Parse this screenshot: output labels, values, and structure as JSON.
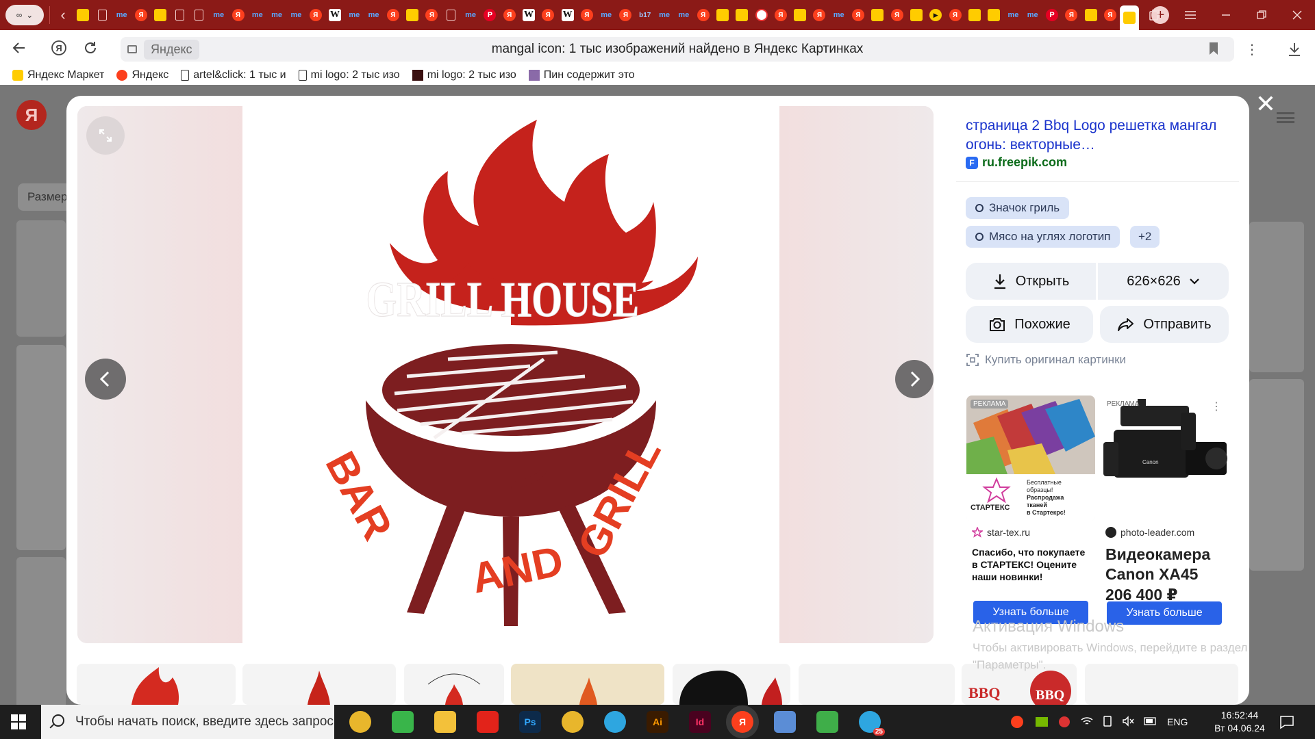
{
  "browser": {
    "window_title": "mangal icon: 1 тыс изображений найдено в Яндекс Картинках",
    "site_chip": "Яндекс",
    "new_tab_symbol": "+",
    "tabs": [
      {
        "icon": "market-icon"
      },
      {
        "icon": "doc-icon"
      },
      {
        "icon": "me-icon",
        "text": "me"
      },
      {
        "icon": "yandex-icon",
        "text": "Я"
      },
      {
        "icon": "market-icon"
      },
      {
        "icon": "doc-icon"
      },
      {
        "icon": "doc-icon"
      },
      {
        "icon": "me-icon",
        "text": "me"
      },
      {
        "icon": "yandex-icon",
        "text": "Я"
      },
      {
        "icon": "me-icon",
        "text": "me"
      },
      {
        "icon": "me-icon",
        "text": "me"
      },
      {
        "icon": "me-icon",
        "text": "me"
      },
      {
        "icon": "yandex-icon",
        "text": "Я"
      },
      {
        "icon": "wiki-icon",
        "text": "W"
      },
      {
        "icon": "me-icon",
        "text": "me"
      },
      {
        "icon": "me-icon",
        "text": "me"
      },
      {
        "icon": "yandex-icon",
        "text": "Я"
      },
      {
        "icon": "market-icon"
      },
      {
        "icon": "yandex-icon",
        "text": "Я"
      },
      {
        "icon": "doc-icon"
      },
      {
        "icon": "me-icon",
        "text": "me"
      },
      {
        "icon": "pinterest-icon",
        "text": "P"
      },
      {
        "icon": "yandex-icon",
        "text": "Я"
      },
      {
        "icon": "wiki-icon",
        "text": "W"
      },
      {
        "icon": "yandex-icon",
        "text": "Я"
      },
      {
        "icon": "wiki-icon",
        "text": "W"
      },
      {
        "icon": "yandex-icon",
        "text": "Я"
      },
      {
        "icon": "me-icon",
        "text": "me"
      },
      {
        "icon": "yandex-icon",
        "text": "Я"
      },
      {
        "icon": "b17-icon",
        "text": "b17"
      },
      {
        "icon": "me-icon",
        "text": "me"
      },
      {
        "icon": "me-icon",
        "text": "me"
      },
      {
        "icon": "yandex-icon",
        "text": "Я"
      },
      {
        "icon": "market-icon"
      },
      {
        "icon": "market-icon"
      },
      {
        "icon": "pokeball-icon"
      },
      {
        "icon": "yandex-icon",
        "text": "Я"
      },
      {
        "icon": "market-icon"
      },
      {
        "icon": "yandex-icon",
        "text": "Я"
      },
      {
        "icon": "me-icon",
        "text": "me"
      },
      {
        "icon": "yandex-icon",
        "text": "Я"
      },
      {
        "icon": "market-icon"
      },
      {
        "icon": "yandex-icon",
        "text": "Я"
      },
      {
        "icon": "market-icon"
      },
      {
        "icon": "play-icon",
        "text": "▶"
      },
      {
        "icon": "yandex-icon",
        "text": "Я"
      },
      {
        "icon": "market-icon"
      },
      {
        "icon": "market-icon"
      },
      {
        "icon": "me-icon",
        "text": "me"
      },
      {
        "icon": "me-icon",
        "text": "me"
      },
      {
        "icon": "pinterest-icon",
        "text": "P"
      },
      {
        "icon": "yandex-icon",
        "text": "Я"
      },
      {
        "icon": "market-icon"
      },
      {
        "icon": "yandex-icon",
        "text": "Я"
      },
      {
        "icon": "market-icon"
      }
    ],
    "bookmarks": [
      {
        "label": "Яндекс Маркет",
        "icon": "market-icon"
      },
      {
        "label": "Яндекс",
        "icon": "yandex-icon"
      },
      {
        "label": "artel&click: 1 тыс и",
        "icon": "doc-icon"
      },
      {
        "label": "mi logo: 2 тыс изо",
        "icon": "doc-icon"
      },
      {
        "label": "mi logo: 2 тыс изо",
        "icon": "image-icon"
      },
      {
        "label": "Пин содержит это",
        "icon": "pin-image-icon"
      }
    ]
  },
  "page": {
    "logo": "Я",
    "filter_chip": "Размер"
  },
  "viewer": {
    "close_symbol": "✕",
    "source": {
      "title": "страница 2 Bbq Logo решетка мангал огонь: векторные…",
      "host": "ru.freepik.com",
      "host_icon": "F"
    },
    "tags": [
      "Значок гриль",
      "Мясо на углях логотип",
      "+2"
    ],
    "actions": {
      "open": "Открыть",
      "size": "626×626",
      "similar": "Похожие",
      "share": "Отправить",
      "buy": "Купить оригинал картинки"
    },
    "image": {
      "title_text": "GRILL HOUSE",
      "arc_left": "BAR",
      "arc_mid": "AND",
      "arc_right": "GRILL",
      "colors": {
        "flame": "#c5221c",
        "grill": "#7d1e20",
        "text": "#e43e22"
      }
    },
    "ads": [
      {
        "label": "РЕКЛАМА",
        "brand": "СТАРТЕКС",
        "promo_lines": [
          "Бесплатные",
          "образцы!",
          "Распродажа",
          "тканей",
          "в Стартекрс!"
        ],
        "site": "star-tex.ru",
        "text": "Спасибо, что покупаете в СТАРТЕКС! Оцените наши новинки!",
        "button": "Узнать больше"
      },
      {
        "label": "РЕКЛАМА",
        "camera_brand": "Canon",
        "site": "photo-leader.com",
        "title": "Видеокамера Canon XA45",
        "price": "206 400 ₽",
        "button": "Узнать больше"
      }
    ]
  },
  "watermark": {
    "line1": "Активация Windows",
    "line2": "Чтобы активировать Windows, перейдите в раздел",
    "line3": "\"Параметры\"."
  },
  "taskbar": {
    "search_placeholder": "Чтобы начать поиск, введите здесь запрос",
    "apps": [
      {
        "name": "chrome-icon"
      },
      {
        "name": "phone-link-icon"
      },
      {
        "name": "file-explorer-icon"
      },
      {
        "name": "huawei-icon"
      },
      {
        "name": "photoshop-icon",
        "text": "Ps"
      },
      {
        "name": "chrome-icon"
      },
      {
        "name": "telegram-icon"
      },
      {
        "name": "illustrator-icon",
        "text": "Ai"
      },
      {
        "name": "indesign-icon",
        "text": "Id"
      },
      {
        "name": "yandex-browser-icon",
        "text": "Я"
      },
      {
        "name": "paint-icon"
      },
      {
        "name": "tool-icon"
      },
      {
        "name": "telegram-icon",
        "badge": "25"
      }
    ],
    "language": "ENG",
    "time": "16:52:44",
    "date": "Вт 04.06.24"
  }
}
